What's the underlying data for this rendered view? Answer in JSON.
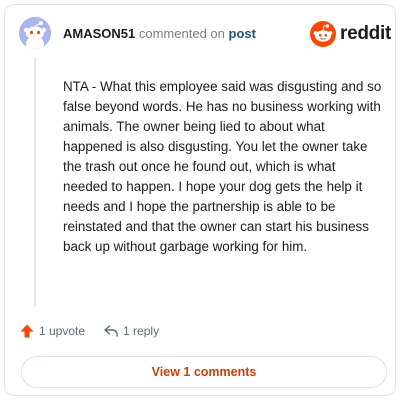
{
  "comment": {
    "username": "AMASON51",
    "action_text": "commented on",
    "post_link_text": "post",
    "body": "NTA - What this employee said was disgusting and so false beyond words. He has no business working with animals. The owner being lied to about what happened is also disgusting. You let the owner take the trash out once he found out, which is what needed to happen. I hope your dog gets the help it needs and I hope the partnership is able to be reinstated and that the owner can start his business back up without garbage working for him.",
    "upvote_label": "1 upvote",
    "reply_label": "1 reply",
    "view_comments_label": "View 1 comments"
  },
  "brand": {
    "logo_text": "reddit",
    "logo_icon": "reddit-snoo-icon"
  },
  "icons": {
    "avatar": "default-snoo-avatar",
    "upvote": "upvote-arrow-icon",
    "reply": "reply-arrow-icon"
  },
  "colors": {
    "accent": "#ff4500",
    "link": "#1d4f91",
    "view_button_text": "#d93a00",
    "avatar_bg": "#a9b4f0",
    "text": "#1c1c1c",
    "muted": "#7c7c7c"
  }
}
